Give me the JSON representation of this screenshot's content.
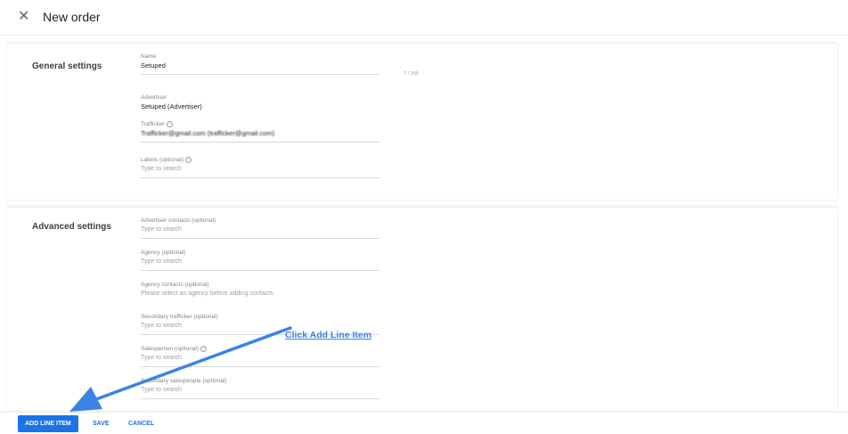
{
  "header": {
    "title": "New order",
    "close_icon": "close-icon"
  },
  "general": {
    "section_title": "General settings",
    "name_label": "Name",
    "name_value": "Setuped",
    "name_counter": "7 / 255",
    "advertiser_label": "Advertiser",
    "advertiser_value": "Setuped (Advertiser)",
    "trafficker_label": "Trafficker",
    "trafficker_value": "Trafficker@gmail.com (trafficker@gmail.com)",
    "labels_label": "Labels (optional)",
    "labels_placeholder": "Type to search"
  },
  "advanced": {
    "section_title": "Advanced settings",
    "advertiser_contacts_label": "Advertiser contacts (optional)",
    "advertiser_contacts_placeholder": "Type to search",
    "agency_label": "Agency (optional)",
    "agency_placeholder": "Type to search",
    "agency_contacts_label": "Agency contacts (optional)",
    "agency_contacts_hint": "Please select an agency before adding contacts",
    "secondary_trafficker_label": "Secondary trafficker (optional)",
    "secondary_trafficker_placeholder": "Type to search",
    "salesperson_label": "Salesperson (optional)",
    "salesperson_placeholder": "Type to search",
    "secondary_salespeople_label": "Secondary salespeople (optional)",
    "secondary_salespeople_placeholder": "Type to search"
  },
  "footer": {
    "add_line_item_label": "ADD LINE ITEM",
    "save_label": "SAVE",
    "cancel_label": "CANCEL"
  },
  "annotation": {
    "callout_text": "Click Add Line Item",
    "color": "#3b82e6"
  },
  "colors": {
    "primary": "#1a73e8",
    "text": "#202124",
    "muted": "#80868b"
  }
}
